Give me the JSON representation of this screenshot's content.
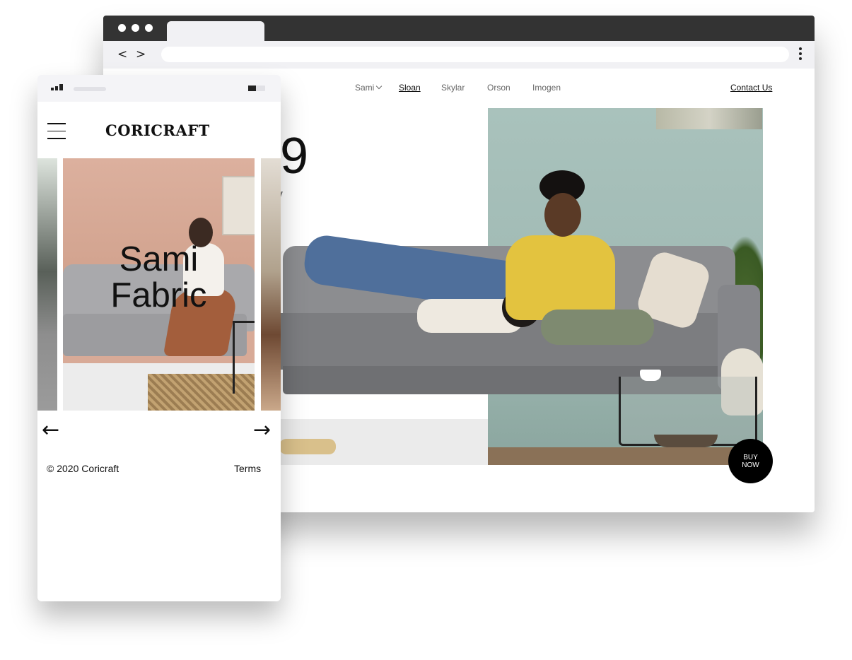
{
  "browser": {
    "nav_back": "<",
    "nav_forward": ">",
    "url": ""
  },
  "desktop": {
    "nav": [
      {
        "label": "Sami"
      },
      {
        "label": "Sloan"
      },
      {
        "label": "Skylar"
      },
      {
        "label": "Orson"
      },
      {
        "label": "Imogen"
      }
    ],
    "contact_label": "Contact Us",
    "price_fragment": "99",
    "label_fragment": "erty",
    "buy_now_line1": "BUY",
    "buy_now_line2": "NOW"
  },
  "mobile": {
    "logo": "CORICRAFT",
    "slide_title_line1": "Sami",
    "slide_title_line2": "Fabric",
    "prev_arrow": "←",
    "next_arrow": "→",
    "copyright": "© 2020 Coricraft",
    "terms": "Terms"
  },
  "colors": {
    "browser_chrome": "#333333",
    "toolbar": "#f1f1f4",
    "accent_black": "#000000"
  }
}
